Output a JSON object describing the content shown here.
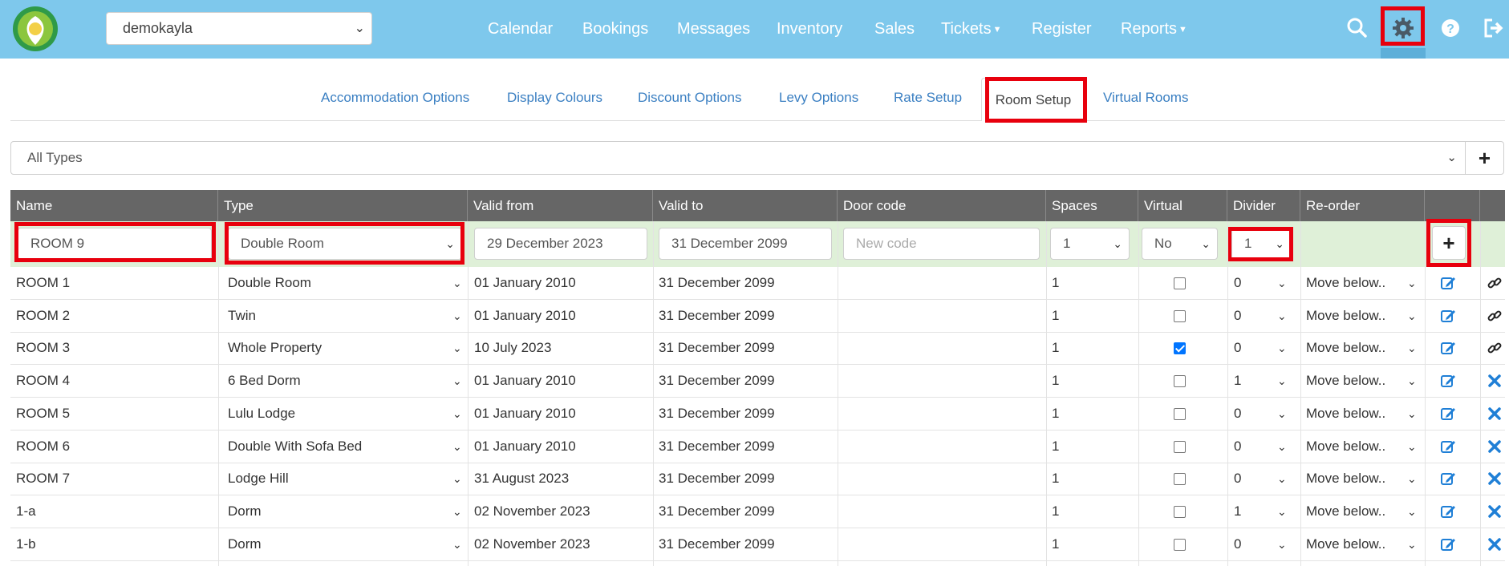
{
  "account": {
    "selected": "demokayla"
  },
  "nav": {
    "items": [
      "Calendar",
      "Bookings",
      "Messages",
      "Inventory",
      "Sales",
      "Tickets",
      "Register",
      "Reports"
    ]
  },
  "tabs": {
    "items": [
      "Accommodation Options",
      "Display Colours",
      "Discount Options",
      "Levy Options",
      "Rate Setup",
      "Room Setup",
      "Virtual Rooms"
    ],
    "active": "Room Setup"
  },
  "filter": {
    "selected": "All Types"
  },
  "table": {
    "headers": [
      "Name",
      "Type",
      "Valid from",
      "Valid to",
      "Door code",
      "Spaces",
      "Virtual",
      "Divider",
      "Re-order"
    ],
    "new_row": {
      "name": "ROOM 9",
      "type": "Double Room",
      "valid_from": "29 December 2023",
      "valid_to": "31 December 2099",
      "door_code_placeholder": "New code",
      "spaces": "1",
      "virtual": "No",
      "divider": "1"
    },
    "rows": [
      {
        "name": "ROOM 1",
        "type": "Double Room",
        "valid_from": "01 January 2010",
        "valid_to": "31 December 2099",
        "spaces": "1",
        "virtual": false,
        "divider": "0",
        "reorder": "Move below..",
        "action": "link"
      },
      {
        "name": "ROOM 2",
        "type": "Twin",
        "valid_from": "01 January 2010",
        "valid_to": "31 December 2099",
        "spaces": "1",
        "virtual": false,
        "divider": "0",
        "reorder": "Move below..",
        "action": "link"
      },
      {
        "name": "ROOM 3",
        "type": "Whole Property",
        "valid_from": "10 July 2023",
        "valid_to": "31 December 2099",
        "spaces": "1",
        "virtual": true,
        "divider": "0",
        "reorder": "Move below..",
        "action": "link"
      },
      {
        "name": "ROOM 4",
        "type": "6 Bed Dorm",
        "valid_from": "01 January 2010",
        "valid_to": "31 December 2099",
        "spaces": "1",
        "virtual": false,
        "divider": "1",
        "reorder": "Move below..",
        "action": "delete"
      },
      {
        "name": "ROOM 5",
        "type": "Lulu Lodge",
        "valid_from": "01 January 2010",
        "valid_to": "31 December 2099",
        "spaces": "1",
        "virtual": false,
        "divider": "0",
        "reorder": "Move below..",
        "action": "delete"
      },
      {
        "name": "ROOM 6",
        "type": "Double With Sofa Bed",
        "valid_from": "01 January 2010",
        "valid_to": "31 December 2099",
        "spaces": "1",
        "virtual": false,
        "divider": "0",
        "reorder": "Move below..",
        "action": "delete"
      },
      {
        "name": "ROOM 7",
        "type": "Lodge Hill",
        "valid_from": "31 August 2023",
        "valid_to": "31 December 2099",
        "spaces": "1",
        "virtual": false,
        "divider": "0",
        "reorder": "Move below..",
        "action": "delete"
      },
      {
        "name": "1-a",
        "type": "Dorm",
        "valid_from": "02 November 2023",
        "valid_to": "31 December 2099",
        "spaces": "1",
        "virtual": false,
        "divider": "1",
        "reorder": "Move below..",
        "action": "delete"
      },
      {
        "name": "1-b",
        "type": "Dorm",
        "valid_from": "02 November 2023",
        "valid_to": "31 December 2099",
        "spaces": "1",
        "virtual": false,
        "divider": "0",
        "reorder": "Move below..",
        "action": "delete"
      }
    ]
  },
  "icons": {
    "search": "search-icon",
    "settings": "gear-icon",
    "help": "help-icon",
    "logout": "logout-icon",
    "add": "plus-icon",
    "edit": "edit-icon",
    "link": "link-icon",
    "delete": "close-icon"
  },
  "colors": {
    "topbar": "#7ec8ec",
    "link": "#3a7fc2",
    "highlight": "#e8000d",
    "table_header": "#666666",
    "new_row": "#dff0d8",
    "action_blue": "#1f7fd6"
  }
}
